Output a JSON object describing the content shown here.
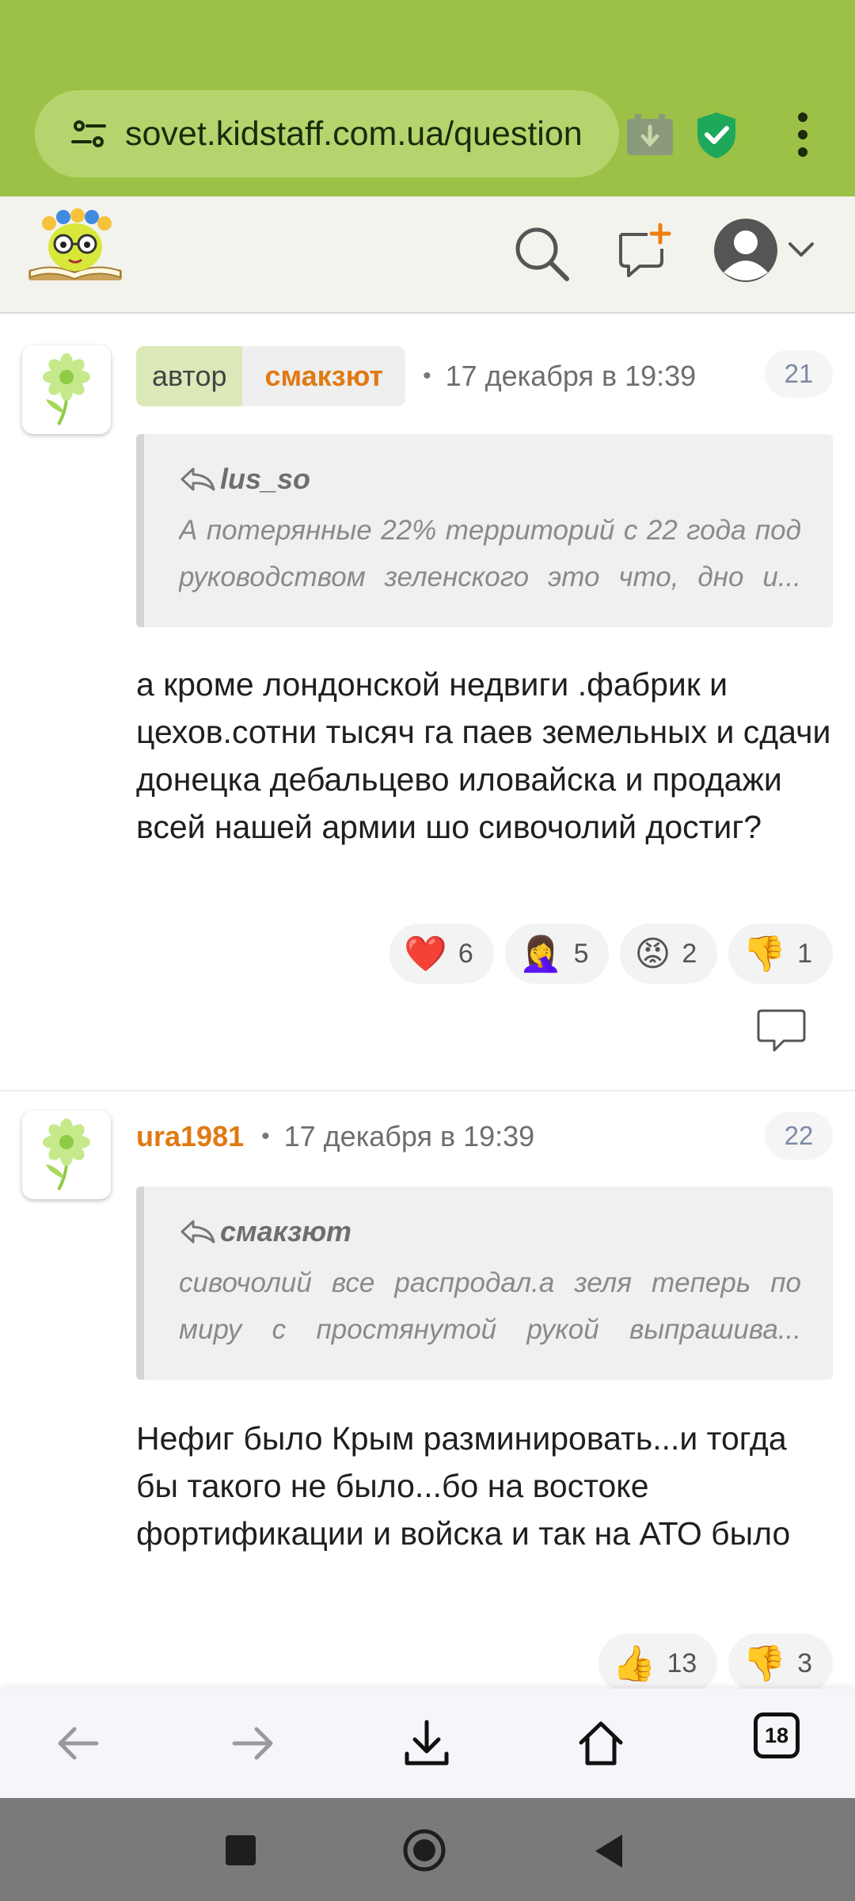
{
  "browser": {
    "url": "sovet.kidstaff.com.ua/question",
    "tabs_count": "18",
    "icons": [
      "site-info-icon",
      "download-page-icon",
      "shield-check-icon",
      "more-vert-icon"
    ]
  },
  "header": {
    "icons": [
      "logo",
      "search-icon",
      "new-post-icon",
      "avatar-icon",
      "chevron-down-icon"
    ]
  },
  "comments": [
    {
      "role_badge": "автор",
      "author": "смакзют",
      "date": "17 декабря в 19:39",
      "number": "21",
      "quote": {
        "author": "lus_so",
        "line1": "А потерянные 22% территорий с 22 года под",
        "line2": "руководством зеленского это что, дно и..."
      },
      "body": "а кроме лондонской недвиги .фабрик и цехов.сотни тысяч га паев земельных и сдачи донецка дебальцево иловайска и продажи всей нашей армии шо сивочолий достиг?",
      "reactions": [
        {
          "emoji": "❤️",
          "count": "6"
        },
        {
          "emoji": "🤦‍♀️",
          "count": "5"
        },
        {
          "emoji": "😡",
          "count": "2"
        },
        {
          "emoji": "👎",
          "count": "1"
        }
      ]
    },
    {
      "author": "ura1981",
      "date": "17 декабря в 19:39",
      "number": "22",
      "quote": {
        "author": "смакзют",
        "line1": "сивочолий все распродал.а зеля теперь по",
        "line2": "миру с простянутой рукой выпрашива..."
      },
      "body": "Нефиг было Крым разминировать...и тогда бы такого не было...бо на востоке фортификации и войска и так на АТО было",
      "reactions": [
        {
          "emoji": "👍",
          "count": "13"
        },
        {
          "emoji": "👎",
          "count": "3"
        }
      ]
    }
  ],
  "colors": {
    "browser_green": "#9cc146",
    "username_orange": "#e07a13",
    "author_badge": "#dbe8b8"
  }
}
